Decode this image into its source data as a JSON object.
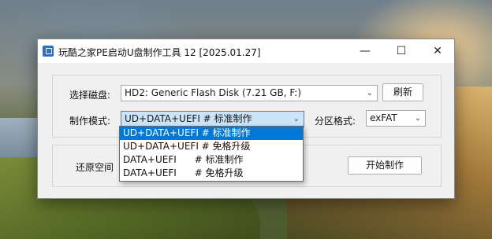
{
  "window": {
    "title": "玩酷之家PE启动U盘制作工具 12 [2025.01.27]",
    "controls": {
      "minimize": "—",
      "maximize": "☐",
      "close": "✕"
    }
  },
  "disk": {
    "label": "选择磁盘:",
    "selected": "HD2: Generic Flash Disk (7.21 GB, F:)",
    "refresh_label": "刷新"
  },
  "mode": {
    "label": "制作模式:",
    "selected": "UD+DATA+UEFI # 标准制作",
    "options": [
      "UD+DATA+UEFI # 标准制作",
      "UD+DATA+UEFI # 免格升级",
      "DATA+UEFI      # 标准制作",
      "DATA+UEFI      # 免格升级"
    ],
    "highlighted_index": 0
  },
  "partition": {
    "label": "分区格式:",
    "selected": "exFAT"
  },
  "restore": {
    "label": "还原空间"
  },
  "progress": {
    "value": 0
  },
  "start": {
    "label": "开始制作"
  },
  "icons": {
    "dropdown_arrow": "chevron-down-icon",
    "app": "usb-app-icon"
  }
}
